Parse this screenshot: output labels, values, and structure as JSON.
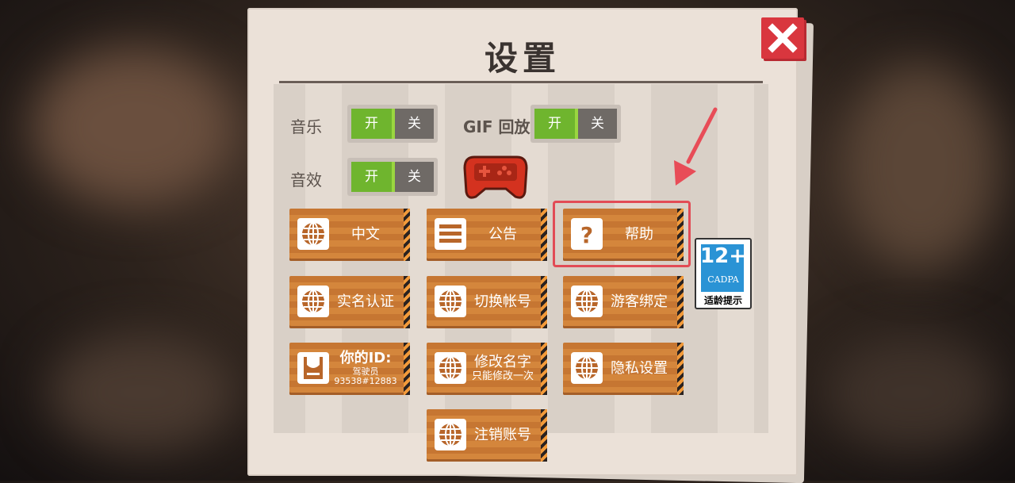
{
  "title": "设置",
  "settings": {
    "music_label": "音乐",
    "sfx_label": "音效",
    "gif_label": "GIF 回放",
    "on_label": "开",
    "off_label": "关"
  },
  "buttons": {
    "language": "中文",
    "notice": "公告",
    "help": "帮助",
    "realname": "实名认证",
    "switch_account": "切换帐号",
    "guest_bind": "游客绑定",
    "your_id": "你的ID:",
    "id_value": "驾驶员93538#12883",
    "rename": "修改名字",
    "rename_note": "只能修改一次",
    "privacy": "隐私设置",
    "cancel_account": "注销账号"
  },
  "age_rating": {
    "age": "12+",
    "org": "CADPA",
    "tip": "适龄提示"
  },
  "colors": {
    "accent_red": "#d9363e",
    "toggle_on": "#6fb52e",
    "button_orange": "#c67632"
  },
  "icons": [
    "close-icon",
    "globe-icon",
    "list-icon",
    "question-icon",
    "id-card-icon",
    "gamepad-icon"
  ]
}
